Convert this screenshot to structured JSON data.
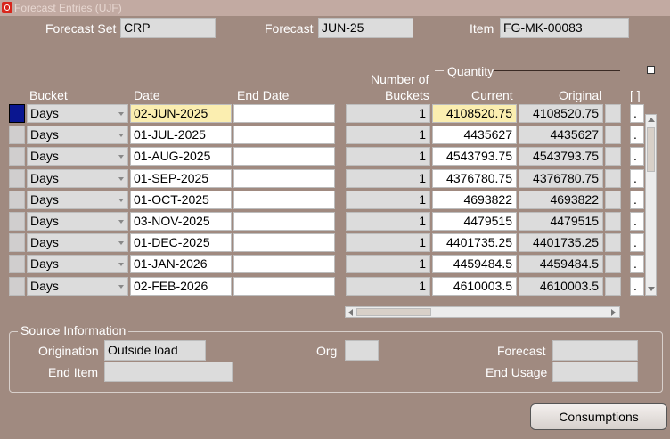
{
  "window": {
    "title": "Forecast Entries (UJF)"
  },
  "header": {
    "forecast_set_label": "Forecast Set",
    "forecast_set_value": "CRP",
    "forecast_label": "Forecast",
    "forecast_value": "JUN-25",
    "item_label": "Item",
    "item_value": "FG-MK-00083"
  },
  "table": {
    "quantity_group": "Quantity",
    "columns": {
      "bucket": "Bucket",
      "date": "Date",
      "end_date": "End Date",
      "num_buckets_1": "Number of",
      "num_buckets_2": "Buckets",
      "current": "Current",
      "original": "Original",
      "flex": "[ ]"
    },
    "rows": [
      {
        "bucket": "Days",
        "date": "02-JUN-2025",
        "end_date": "",
        "buckets": "1",
        "current": "4108520.75",
        "original": "4108520.75",
        "flex": "."
      },
      {
        "bucket": "Days",
        "date": "01-JUL-2025",
        "end_date": "",
        "buckets": "1",
        "current": "4435627",
        "original": "4435627",
        "flex": "."
      },
      {
        "bucket": "Days",
        "date": "01-AUG-2025",
        "end_date": "",
        "buckets": "1",
        "current": "4543793.75",
        "original": "4543793.75",
        "flex": "."
      },
      {
        "bucket": "Days",
        "date": "01-SEP-2025",
        "end_date": "",
        "buckets": "1",
        "current": "4376780.75",
        "original": "4376780.75",
        "flex": "."
      },
      {
        "bucket": "Days",
        "date": "01-OCT-2025",
        "end_date": "",
        "buckets": "1",
        "current": "4693822",
        "original": "4693822",
        "flex": "."
      },
      {
        "bucket": "Days",
        "date": "03-NOV-2025",
        "end_date": "",
        "buckets": "1",
        "current": "4479515",
        "original": "4479515",
        "flex": "."
      },
      {
        "bucket": "Days",
        "date": "01-DEC-2025",
        "end_date": "",
        "buckets": "1",
        "current": "4401735.25",
        "original": "4401735.25",
        "flex": "."
      },
      {
        "bucket": "Days",
        "date": "01-JAN-2026",
        "end_date": "",
        "buckets": "1",
        "current": "4459484.5",
        "original": "4459484.5",
        "flex": "."
      },
      {
        "bucket": "Days",
        "date": "02-FEB-2026",
        "end_date": "",
        "buckets": "1",
        "current": "4610003.5",
        "original": "4610003.5",
        "flex": "."
      }
    ]
  },
  "source": {
    "title": "Source Information",
    "origination_label": "Origination",
    "origination_value": "Outside load",
    "org_label": "Org",
    "org_value": "",
    "forecast_label": "Forecast",
    "forecast_value": "",
    "end_item_label": "End Item",
    "end_item_value": "",
    "end_usage_label": "End Usage",
    "end_usage_value": ""
  },
  "buttons": {
    "consumptions": "Consumptions"
  },
  "colors": {
    "background": "#a08a80",
    "active_row": "#0a1690",
    "current_cell": "#fbeeb0"
  }
}
